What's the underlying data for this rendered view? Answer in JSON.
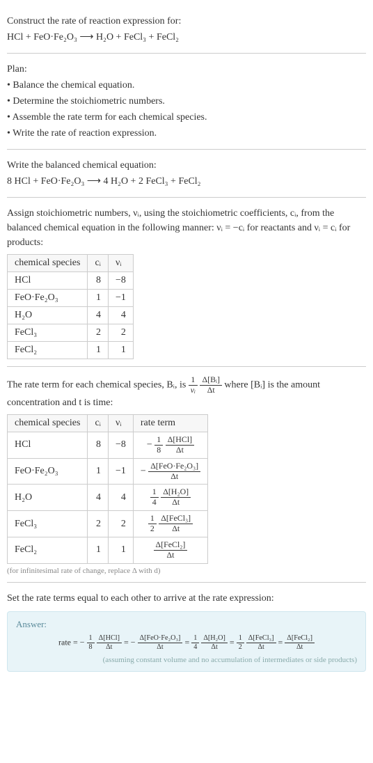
{
  "intro": {
    "title": "Construct the rate of reaction expression for:",
    "equation": "HCl + FeO·Fe₂O₃ ⟶ H₂O + FeCl₃ + FeCl₂"
  },
  "plan": {
    "heading": "Plan:",
    "items": [
      "• Balance the chemical equation.",
      "• Determine the stoichiometric numbers.",
      "• Assemble the rate term for each chemical species.",
      "• Write the rate of reaction expression."
    ]
  },
  "balanced": {
    "heading": "Write the balanced chemical equation:",
    "equation": "8 HCl + FeO·Fe₂O₃ ⟶ 4 H₂O + 2 FeCl₃ + FeCl₂"
  },
  "assign": {
    "text1": "Assign stoichiometric numbers, νᵢ, using the stoichiometric coefficients, cᵢ, from the balanced chemical equation in the following manner: νᵢ = −cᵢ for reactants and νᵢ = cᵢ for products:",
    "headers": [
      "chemical species",
      "cᵢ",
      "νᵢ"
    ],
    "rows": [
      {
        "species": "HCl",
        "c": "8",
        "v": "−8"
      },
      {
        "species": "FeO·Fe₂O₃",
        "c": "1",
        "v": "−1"
      },
      {
        "species": "H₂O",
        "c": "4",
        "v": "4"
      },
      {
        "species": "FeCl₃",
        "c": "2",
        "v": "2"
      },
      {
        "species": "FeCl₂",
        "c": "1",
        "v": "1"
      }
    ]
  },
  "rateterm": {
    "text_before": "The rate term for each chemical species, Bᵢ, is",
    "frac1_num": "1",
    "frac1_den": "νᵢ",
    "frac2_num": "Δ[Bᵢ]",
    "frac2_den": "Δt",
    "text_after": "where [Bᵢ] is the amount concentration and t is time:",
    "headers": [
      "chemical species",
      "cᵢ",
      "νᵢ",
      "rate term"
    ],
    "rows": [
      {
        "species": "HCl",
        "c": "8",
        "v": "−8",
        "rt_pre": "−",
        "rt_a_num": "1",
        "rt_a_den": "8",
        "rt_b_num": "Δ[HCl]",
        "rt_b_den": "Δt"
      },
      {
        "species": "FeO·Fe₂O₃",
        "c": "1",
        "v": "−1",
        "rt_pre": "−",
        "rt_a_num": "",
        "rt_a_den": "",
        "rt_b_num": "Δ[FeO·Fe₂O₃]",
        "rt_b_den": "Δt"
      },
      {
        "species": "H₂O",
        "c": "4",
        "v": "4",
        "rt_pre": "",
        "rt_a_num": "1",
        "rt_a_den": "4",
        "rt_b_num": "Δ[H₂O]",
        "rt_b_den": "Δt"
      },
      {
        "species": "FeCl₃",
        "c": "2",
        "v": "2",
        "rt_pre": "",
        "rt_a_num": "1",
        "rt_a_den": "2",
        "rt_b_num": "Δ[FeCl₃]",
        "rt_b_den": "Δt"
      },
      {
        "species": "FeCl₂",
        "c": "1",
        "v": "1",
        "rt_pre": "",
        "rt_a_num": "",
        "rt_a_den": "",
        "rt_b_num": "Δ[FeCl₂]",
        "rt_b_den": "Δt"
      }
    ],
    "note": "(for infinitesimal rate of change, replace Δ with d)"
  },
  "final": {
    "heading": "Set the rate terms equal to each other to arrive at the rate expression:"
  },
  "answer": {
    "label": "Answer:",
    "prefix": "rate = −",
    "t1_a_num": "1",
    "t1_a_den": "8",
    "t1_b_num": "Δ[HCl]",
    "t1_b_den": "Δt",
    "eq1": " = −",
    "t2_b_num": "Δ[FeO·Fe₂O₃]",
    "t2_b_den": "Δt",
    "eq2": " = ",
    "t3_a_num": "1",
    "t3_a_den": "4",
    "t3_b_num": "Δ[H₂O]",
    "t3_b_den": "Δt",
    "eq3": " = ",
    "t4_a_num": "1",
    "t4_a_den": "2",
    "t4_b_num": "Δ[FeCl₃]",
    "t4_b_den": "Δt",
    "eq4": " = ",
    "t5_b_num": "Δ[FeCl₂]",
    "t5_b_den": "Δt",
    "note": "(assuming constant volume and no accumulation of intermediates or side products)"
  },
  "chart_data": {
    "type": "table",
    "title": "Stoichiometric numbers and rate terms",
    "tables": [
      {
        "headers": [
          "chemical species",
          "c_i",
          "ν_i"
        ],
        "rows": [
          [
            "HCl",
            8,
            -8
          ],
          [
            "FeO·Fe2O3",
            1,
            -1
          ],
          [
            "H2O",
            4,
            4
          ],
          [
            "FeCl3",
            2,
            2
          ],
          [
            "FeCl2",
            1,
            1
          ]
        ]
      },
      {
        "headers": [
          "chemical species",
          "c_i",
          "ν_i",
          "rate term"
        ],
        "rows": [
          [
            "HCl",
            8,
            -8,
            "-(1/8) Δ[HCl]/Δt"
          ],
          [
            "FeO·Fe2O3",
            1,
            -1,
            "-Δ[FeO·Fe2O3]/Δt"
          ],
          [
            "H2O",
            4,
            4,
            "(1/4) Δ[H2O]/Δt"
          ],
          [
            "FeCl3",
            2,
            2,
            "(1/2) Δ[FeCl3]/Δt"
          ],
          [
            "FeCl2",
            1,
            1,
            "Δ[FeCl2]/Δt"
          ]
        ]
      }
    ]
  }
}
